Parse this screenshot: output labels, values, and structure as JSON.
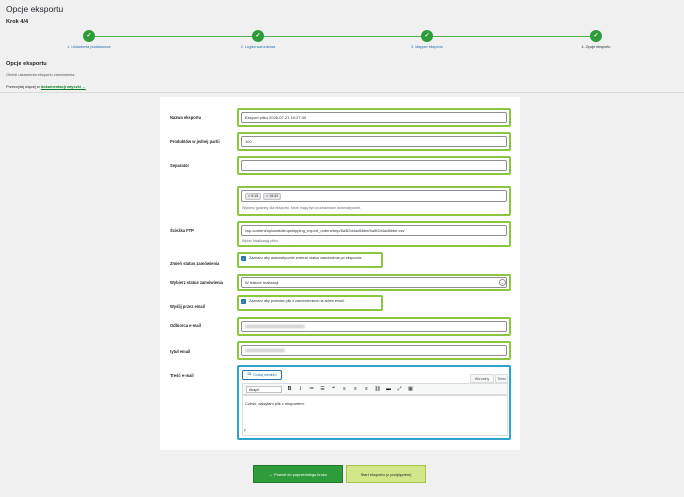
{
  "page": {
    "title": "Opcje eksportu",
    "step": "Krok 4/4"
  },
  "stepper": {
    "check_icon": "✓",
    "steps": [
      {
        "label": "1. Ustawienia podstawowe",
        "done": true
      },
      {
        "label": "2. Logika warunkowa",
        "done": true
      },
      {
        "label": "3. Mapper eksportu",
        "done": true
      },
      {
        "label": "4. Opcje eksportu",
        "done": true,
        "current": true
      }
    ]
  },
  "section": {
    "title": "Opcje eksportu",
    "description": "Określ ustawienia eksportu zamówienia.",
    "docs_prefix": "Przeczytaj więcej w ",
    "docs_link": "dokumentacji wtyczki →"
  },
  "form": {
    "export_name": {
      "label": "Nazwa eksportu",
      "value": "Eksport pliku 2026-07-21 10:27:40"
    },
    "products_per_part": {
      "label": "Produktów w jednej partii",
      "value": "100"
    },
    "separator": {
      "label": "Separator",
      "value": ","
    },
    "schedule": {
      "chips": [
        "× 0:15",
        "× 15:32"
      ],
      "hint": "Wybierz godziny dla eksportu, które mają być uruchamiane automatycznie."
    },
    "ftp_path": {
      "label": "Ścieżka FTP",
      "value": "/wp-content/uploads/dropshipping_export_orders/tmp/6a5f2d4ad6bbe/6a5f2d4ad6bbe.csv",
      "hint": "Wpisz lokalizację pliku."
    },
    "change_status": {
      "label": "Zmień status zamówienia",
      "checkbox_text": "Zaznacz aby automatycznie zmienić status zamówienia po eksporcie."
    },
    "order_status": {
      "label": "Wybierz status zamówienia",
      "value": "W trakcie realizacji"
    },
    "send_email": {
      "label": "Wyślij przez email",
      "checkbox_text": "Zaznacz aby przesłać plik z zamówieniami na adres email."
    },
    "recipient": {
      "label": "Odbiorca e-mail"
    },
    "subject": {
      "label": "tytuł email"
    },
    "body": {
      "label": "Treść e-mail",
      "add_media": "Dodaj medium",
      "tab_visual": "Wizualny",
      "tab_text": "Tekst",
      "format_select": "Akapit",
      "content": "Cześć, wysyłam plik z eksportem.",
      "path": "p"
    }
  },
  "buttons": {
    "prev": "← Powrót do poprzedniego kroku",
    "start": "Start eksportu (z podpięciem)"
  },
  "colors": {
    "accent_green": "#2e9c3a",
    "highlight": "#8cc63f",
    "editor_highlight": "#2ea2cc",
    "start_button": "#d2e68a"
  }
}
